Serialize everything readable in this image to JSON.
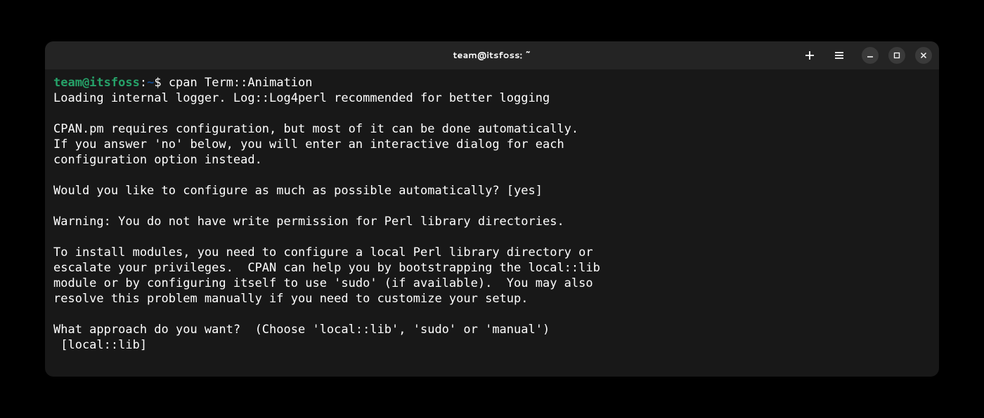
{
  "window": {
    "title": "team@itsfoss: ~"
  },
  "prompt": {
    "user_host": "team@itsfoss",
    "sep1": ":",
    "path": "~",
    "sep2": "$ ",
    "command": "cpan Term::Animation"
  },
  "output": {
    "line1": "Loading internal logger. Log::Log4perl recommended for better logging",
    "blank1": "",
    "line2": "CPAN.pm requires configuration, but most of it can be done automatically.",
    "line3": "If you answer 'no' below, you will enter an interactive dialog for each",
    "line4": "configuration option instead.",
    "blank2": "",
    "line5": "Would you like to configure as much as possible automatically? [yes]",
    "blank3": "",
    "line6": "Warning: You do not have write permission for Perl library directories.",
    "blank4": "",
    "line7": "To install modules, you need to configure a local Perl library directory or",
    "line8": "escalate your privileges.  CPAN can help you by bootstrapping the local::lib",
    "line9": "module or by configuring itself to use 'sudo' (if available).  You may also",
    "line10": "resolve this problem manually if you need to customize your setup.",
    "blank5": "",
    "line11": "What approach do you want?  (Choose 'local::lib', 'sudo' or 'manual')",
    "line12": " [local::lib]"
  }
}
